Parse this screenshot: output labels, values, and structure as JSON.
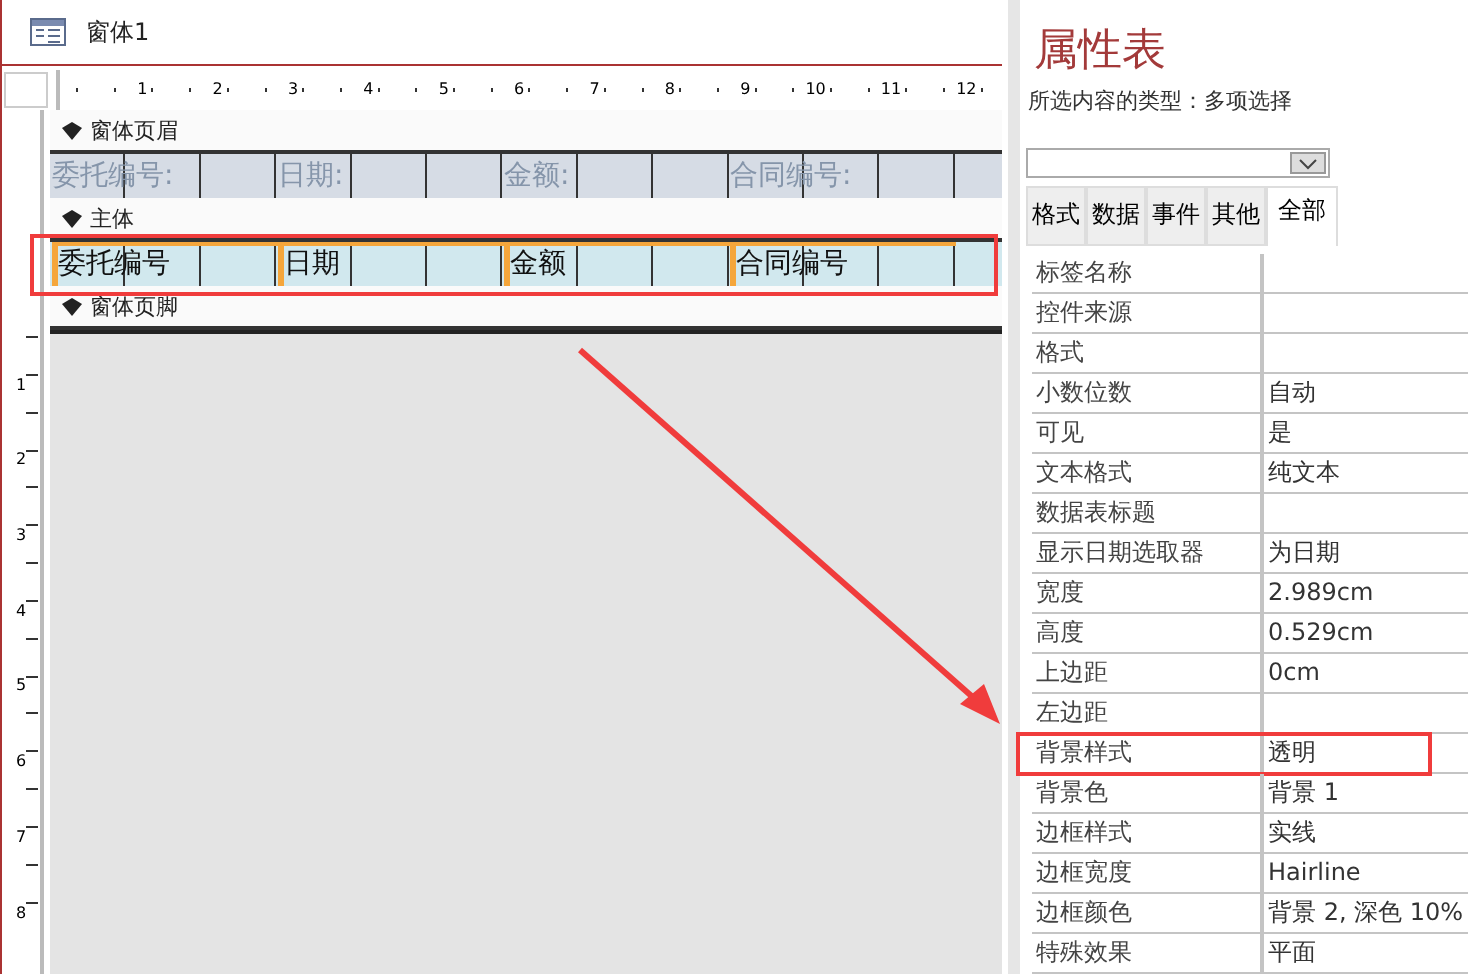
{
  "form_window": {
    "title": "窗体1",
    "ruler_marks": [
      "1",
      "2",
      "3",
      "4",
      "5",
      "6",
      "7",
      "8",
      "9",
      "10",
      "11",
      "12"
    ],
    "vertical_ruler_marks": [
      "1",
      "2",
      "3",
      "4",
      "5",
      "6",
      "7",
      "8"
    ],
    "sections": [
      {
        "title": "窗体页眉",
        "highlighted": false,
        "controls": [
          {
            "kind": "label",
            "text": "委托编号:",
            "selected": false
          },
          {
            "kind": "label",
            "text": "日期:",
            "selected": false
          },
          {
            "kind": "label",
            "text": "金额:",
            "selected": false
          },
          {
            "kind": "label",
            "text": "合同编号:",
            "selected": false
          }
        ]
      },
      {
        "title": "主体",
        "highlighted": true,
        "controls": [
          {
            "kind": "textbox",
            "text": "委托编号",
            "selected": true
          },
          {
            "kind": "textbox",
            "text": "日期",
            "selected": true
          },
          {
            "kind": "textbox",
            "text": "金额",
            "selected": true
          },
          {
            "kind": "textbox",
            "text": "合同编号",
            "selected": true
          }
        ]
      },
      {
        "title": "窗体页脚",
        "highlighted": false
      }
    ]
  },
  "property_sheet": {
    "title": "属性表",
    "selection_type": "所选内容的类型：多项选择",
    "tabs": [
      {
        "label": "格式",
        "selected": false
      },
      {
        "label": "数据",
        "selected": false
      },
      {
        "label": "事件",
        "selected": false
      },
      {
        "label": "其他",
        "selected": false
      },
      {
        "label": "全部",
        "selected": true
      }
    ],
    "rows": [
      {
        "name": "标签名称",
        "value": "",
        "highlighted": false
      },
      {
        "name": "控件来源",
        "value": "",
        "highlighted": false
      },
      {
        "name": "格式",
        "value": "",
        "highlighted": false
      },
      {
        "name": "小数位数",
        "value": "自动",
        "highlighted": false
      },
      {
        "name": "可见",
        "value": "是",
        "highlighted": false
      },
      {
        "name": "文本格式",
        "value": "纯文本",
        "highlighted": false
      },
      {
        "name": "数据表标题",
        "value": "",
        "highlighted": false
      },
      {
        "name": "显示日期选取器",
        "value": "为日期",
        "highlighted": false
      },
      {
        "name": "宽度",
        "value": "2.989cm",
        "highlighted": false
      },
      {
        "name": "高度",
        "value": "0.529cm",
        "highlighted": false
      },
      {
        "name": "上边距",
        "value": "0cm",
        "highlighted": false
      },
      {
        "name": "左边距",
        "value": "",
        "highlighted": false
      },
      {
        "name": "背景样式",
        "value": "透明",
        "highlighted": true
      },
      {
        "name": "背景色",
        "value": "背景 1",
        "highlighted": false
      },
      {
        "name": "边框样式",
        "value": "实线",
        "highlighted": false
      },
      {
        "name": "边框宽度",
        "value": "Hairline",
        "highlighted": false
      },
      {
        "name": "边框颜色",
        "value": "背景 2, 深色 10%",
        "highlighted": false
      },
      {
        "name": "特殊效果",
        "value": "平面",
        "highlighted": false
      }
    ]
  }
}
